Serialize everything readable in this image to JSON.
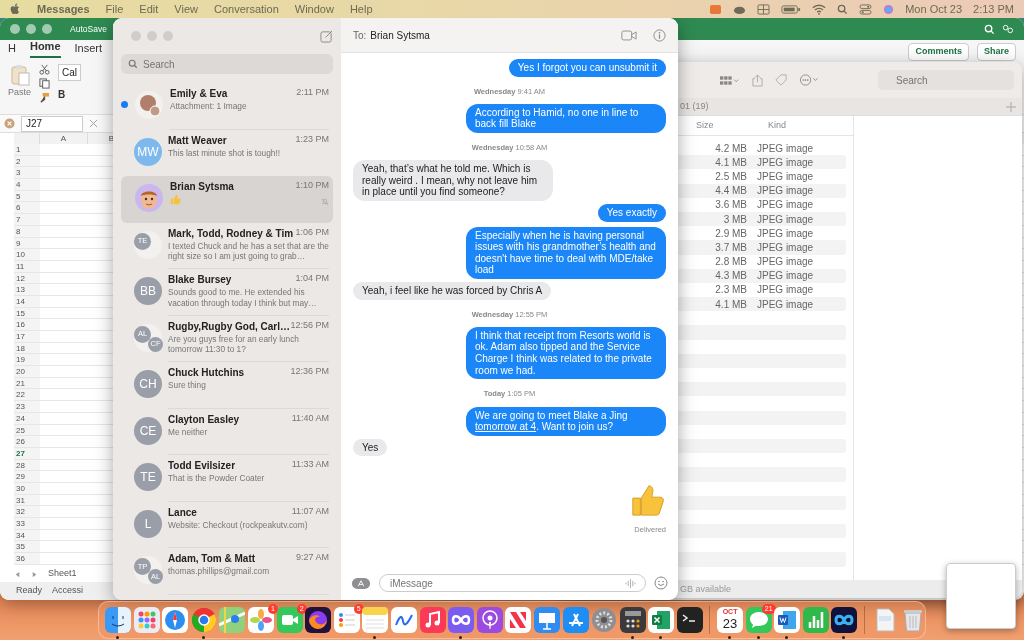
{
  "menu_bar": {
    "app_name": "Messages",
    "menus": [
      "File",
      "Edit",
      "View",
      "Conversation",
      "Window",
      "Help"
    ],
    "date": "Mon Oct 23",
    "time": "2:13 PM"
  },
  "excel": {
    "title": "AutoSave",
    "ribbon_tabs": [
      {
        "label": "H",
        "selected": false
      },
      {
        "label": "Home",
        "selected": true
      },
      {
        "label": "Insert",
        "selected": false
      }
    ],
    "paste_label": "Paste",
    "font_name": "Cal",
    "bold_label": "B",
    "name_box": "J27",
    "comments_button": "Comments",
    "share_button": "Share",
    "columns": [
      "A",
      "B"
    ],
    "rows": [
      {
        "label": "1",
        "selected": false
      },
      {
        "label": "2",
        "selected": false
      },
      {
        "label": "3",
        "selected": false
      },
      {
        "label": "4",
        "selected": false
      },
      {
        "label": "5",
        "selected": false
      },
      {
        "label": "6",
        "selected": false
      },
      {
        "label": "7",
        "selected": false
      },
      {
        "label": "8",
        "selected": false
      },
      {
        "label": "9",
        "selected": false
      },
      {
        "label": "10",
        "selected": false
      },
      {
        "label": "11",
        "selected": false
      },
      {
        "label": "12",
        "selected": false
      },
      {
        "label": "13",
        "selected": false
      },
      {
        "label": "14",
        "selected": false
      },
      {
        "label": "15",
        "selected": false
      },
      {
        "label": "16",
        "selected": false
      },
      {
        "label": "17",
        "selected": false
      },
      {
        "label": "18",
        "selected": false
      },
      {
        "label": "19",
        "selected": false
      },
      {
        "label": "20",
        "selected": false
      },
      {
        "label": "21",
        "selected": false
      },
      {
        "label": "22",
        "selected": false
      },
      {
        "label": "23",
        "selected": false
      },
      {
        "label": "24",
        "selected": false
      },
      {
        "label": "25",
        "selected": false
      },
      {
        "label": "26",
        "selected": false
      },
      {
        "label": "27",
        "selected": true
      },
      {
        "label": "28",
        "selected": false
      },
      {
        "label": "29",
        "selected": false
      },
      {
        "label": "30",
        "selected": false
      },
      {
        "label": "31",
        "selected": false
      },
      {
        "label": "32",
        "selected": false
      },
      {
        "label": "33",
        "selected": false
      },
      {
        "label": "34",
        "selected": false
      },
      {
        "label": "35",
        "selected": false
      },
      {
        "label": "36",
        "selected": false
      }
    ],
    "sheet_tab": "Sheet1",
    "status": "Ready",
    "accessibility": "Accessi"
  },
  "finder": {
    "search_placeholder": "Search",
    "path": "01 (19)",
    "columns": [
      "Size",
      "Kind"
    ],
    "rows": [
      {
        "size": "4.2 MB",
        "kind": "JPEG image"
      },
      {
        "size": "4.1 MB",
        "kind": "JPEG image"
      },
      {
        "size": "2.5 MB",
        "kind": "JPEG image"
      },
      {
        "size": "4.4 MB",
        "kind": "JPEG image"
      },
      {
        "size": "3.6 MB",
        "kind": "JPEG image"
      },
      {
        "size": "3 MB",
        "kind": "JPEG image"
      },
      {
        "size": "2.9 MB",
        "kind": "JPEG image"
      },
      {
        "size": "3.7 MB",
        "kind": "JPEG image"
      },
      {
        "size": "2.8 MB",
        "kind": "JPEG image"
      },
      {
        "size": "4.3 MB",
        "kind": "JPEG image"
      },
      {
        "size": "2.3 MB",
        "kind": "JPEG image"
      },
      {
        "size": "4.1 MB",
        "kind": "JPEG image"
      }
    ],
    "footer": "GB available"
  },
  "messages": {
    "search_placeholder": "Search",
    "conversations": [
      {
        "kind": "text",
        "name": "Emily & Eva",
        "time": "2:11 PM",
        "preview": "Attachment: 1 Image",
        "avatar": {
          "kind": "photo"
        },
        "unread": true,
        "selected": false,
        "muted": false
      },
      {
        "kind": "text",
        "name": "Matt Weaver",
        "time": "1:23 PM",
        "preview": "This last minute shot is tough!!",
        "avatar": {
          "kind": "initials",
          "initials": [
            "MW"
          ],
          "color": "#7db9ec"
        },
        "unread": false,
        "selected": false,
        "muted": false
      },
      {
        "kind": "emoji",
        "name": "Brian Sytsma",
        "time": "1:10 PM",
        "avatar": {
          "kind": "memoji"
        },
        "unread": false,
        "selected": true,
        "muted": true
      },
      {
        "kind": "text",
        "name": "Mark, Todd, Rodney & Tim",
        "time": "1:06 PM",
        "preview": "I texted Chuck and he has a set that are the right size so I am just going to grab…",
        "avatar": {
          "kind": "group",
          "initials": [
            "TE"
          ]
        },
        "unread": false,
        "selected": false,
        "muted": false
      },
      {
        "kind": "text",
        "name": "Blake Bursey",
        "time": "1:04 PM",
        "preview": "Sounds good to me.  He extended his vacation through today I think but may…",
        "avatar": {
          "kind": "initials",
          "initials": [
            "BB"
          ],
          "color": "#9a9ea8"
        },
        "unread": false,
        "selected": false,
        "muted": false
      },
      {
        "kind": "text",
        "name": "Rugby,Rugby God, Carl…",
        "time": "12:56 PM",
        "preview": "Are you guys free for an early lunch tomorrow 11:30 to 1?",
        "avatar": {
          "kind": "group",
          "initials": [
            "AL",
            "CF"
          ]
        },
        "unread": false,
        "selected": false,
        "muted": false
      },
      {
        "kind": "text",
        "name": "Chuck Hutchins",
        "time": "12:36 PM",
        "preview": "Sure thing",
        "avatar": {
          "kind": "initials",
          "initials": [
            "CH"
          ],
          "color": "#9a9ea8"
        },
        "unread": false,
        "selected": false,
        "muted": false
      },
      {
        "kind": "text",
        "name": "Clayton Easley",
        "time": "11:40 AM",
        "preview": "Me neither",
        "avatar": {
          "kind": "initials",
          "initials": [
            "CE"
          ],
          "color": "#9a9ea8"
        },
        "unread": false,
        "selected": false,
        "muted": false
      },
      {
        "kind": "text",
        "name": "Todd Evilsizer",
        "time": "11:33 AM",
        "preview": "That is the Powder Coater",
        "avatar": {
          "kind": "initials",
          "initials": [
            "TE"
          ],
          "color": "#9a9ea8"
        },
        "unread": false,
        "selected": false,
        "muted": false
      },
      {
        "kind": "text",
        "name": "Lance",
        "time": "11:07 AM",
        "preview": "Website: Checkout (rockpeakutv.com)",
        "avatar": {
          "kind": "initials",
          "initials": [
            "L"
          ],
          "color": "#9a9ea8"
        },
        "unread": false,
        "selected": false,
        "muted": false
      },
      {
        "kind": "text",
        "name": "Adam, Tom & Matt",
        "time": "9:27 AM",
        "preview": "thomas.phillips@gmail.com",
        "avatar": {
          "kind": "group",
          "initials": [
            "TP",
            "AL"
          ]
        },
        "unread": false,
        "selected": false,
        "muted": false
      }
    ],
    "chat": {
      "to_label": "To:",
      "recipient": "Brian Sytsma",
      "items": [
        {
          "kind": "sent",
          "text": "Yes I forgot you can unsubmit it"
        },
        {
          "kind": "timestamp",
          "text": "**Wednesday** 9:41 AM"
        },
        {
          "kind": "sent",
          "text": "According to Hamid, no one in line to back fill Blake"
        },
        {
          "kind": "timestamp",
          "text": "**Wednesday** 10:58 AM"
        },
        {
          "kind": "received",
          "text": "Yeah, that’s what he told me. Which is really weird . I mean, why not leave him in place until you find someone?"
        },
        {
          "kind": "sent",
          "text": "Yes exactly"
        },
        {
          "kind": "sent",
          "text": "Especially when he is having personal issues with his grandmother’s health and doesn't have time to deal with MDE/take load"
        },
        {
          "kind": "received",
          "text": "Yeah, i feel like he was forced by Chris A"
        },
        {
          "kind": "timestamp",
          "text": "**Wednesday** 12:55 PM"
        },
        {
          "kind": "sent",
          "text": "I think that receipt from Resorts world is ok.  Adam also tipped and the Service Charge I think was related to the private room we had."
        },
        {
          "kind": "timestamp",
          "text": "**Today** 1:05 PM"
        },
        {
          "kind": "sent",
          "text": "We are going to meet Blake a Jing ",
          "link": "tomorrow at 4",
          "after": ".  Want to join us?"
        },
        {
          "kind": "received",
          "text": "Yes"
        },
        {
          "kind": "emoji"
        }
      ],
      "status": "Delivered",
      "input_placeholder": "iMessage"
    }
  },
  "dock": {
    "groups": [
      [
        {
          "running": true
        },
        {
          "running": false
        },
        {
          "running": false
        },
        {
          "running": true
        },
        {
          "running": false
        },
        {
          "running": false,
          "badge": "1"
        },
        {
          "running": false,
          "badge": "2"
        },
        {
          "running": false
        },
        {
          "running": false,
          "badge": "5"
        },
        {
          "running": true
        },
        {
          "running": false
        },
        {
          "running": false
        },
        {
          "running": true
        },
        {
          "running": false
        },
        {
          "running": false
        },
        {
          "running": false
        },
        {
          "running": false
        },
        {
          "running": false
        },
        {
          "running": true
        },
        {
          "running": true
        },
        {
          "running": false
        }
      ],
      [
        {
          "running": true,
          "month": "OCT",
          "day": "23"
        },
        {
          "running": true,
          "badge": "21"
        },
        {
          "running": true
        },
        {
          "running": false
        },
        {
          "running": true
        }
      ],
      [
        {
          "running": false
        },
        {
          "running": false
        }
      ]
    ]
  }
}
